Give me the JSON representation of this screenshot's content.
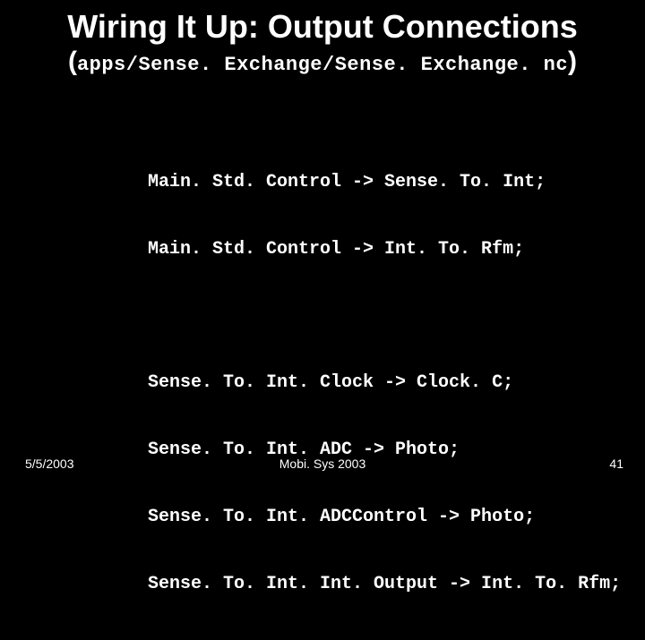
{
  "title": "Wiring It Up: Output Connections",
  "subtitle_path": "apps/Sense. Exchange/Sense. Exchange. nc",
  "code": {
    "block1": [
      "Main. Std. Control -> Sense. To. Int;",
      "Main. Std. Control -> Int. To. Rfm;"
    ],
    "block2": [
      "Sense. To. Int. Clock -> Clock. C;",
      "Sense. To. Int. ADC -> Photo;",
      "Sense. To. Int. ADCControl -> Photo;",
      "Sense. To. Int. Int. Output -> Int. To. Rfm;"
    ]
  },
  "footer": {
    "date": "5/5/2003",
    "venue": "Mobi. Sys 2003",
    "page": "41"
  }
}
